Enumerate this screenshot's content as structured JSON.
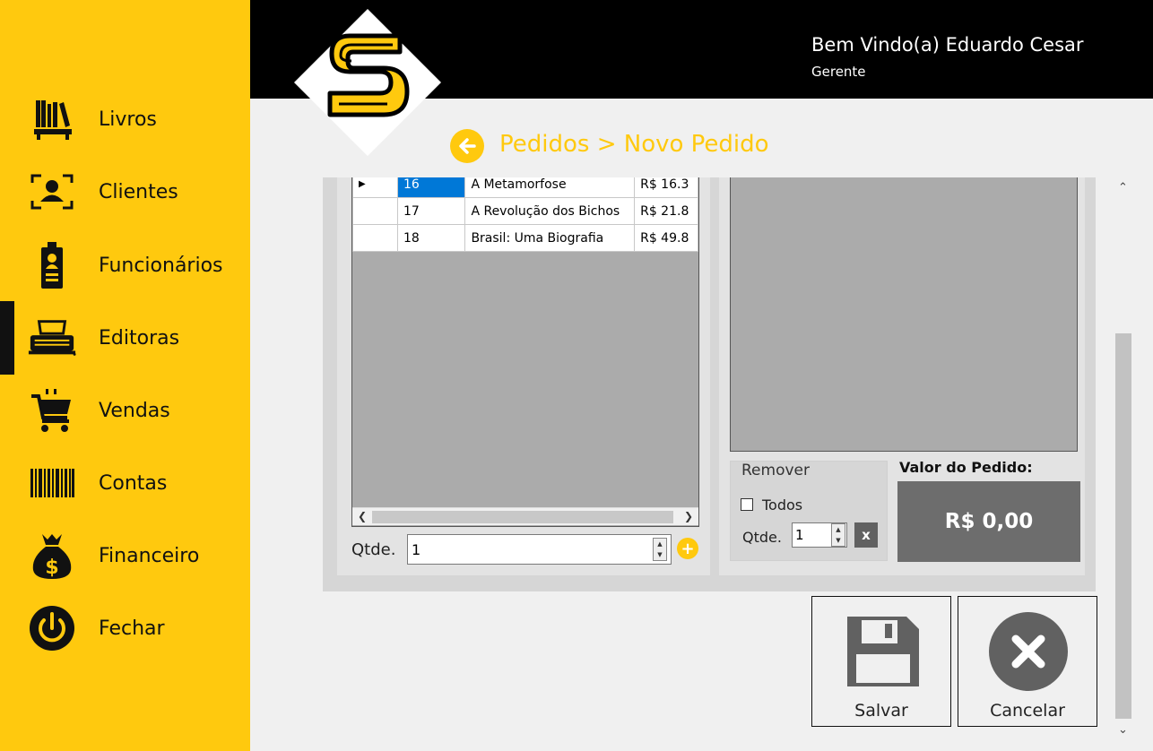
{
  "header": {
    "welcome": "Bem Vindo(a) Eduardo Cesar",
    "role": "Gerente"
  },
  "sidebar": {
    "items": [
      {
        "label": "Livros",
        "icon": "books-icon"
      },
      {
        "label": "Clientes",
        "icon": "client-icon"
      },
      {
        "label": "Funcionários",
        "icon": "badge-icon"
      },
      {
        "label": "Editoras",
        "icon": "typewriter-icon"
      },
      {
        "label": "Vendas",
        "icon": "cart-icon"
      },
      {
        "label": "Contas",
        "icon": "barcode-icon"
      },
      {
        "label": "Financeiro",
        "icon": "money-bag-icon"
      },
      {
        "label": "Fechar",
        "icon": "power-icon"
      }
    ],
    "active": "Editoras"
  },
  "logo": {
    "letter": "S"
  },
  "breadcrumb": "Pedidos > Novo Pedido",
  "books_grid": {
    "rows": [
      {
        "id": "16",
        "title": "A Metamorfose",
        "price": "R$ 16.3",
        "selected": true
      },
      {
        "id": "17",
        "title": "A Revolução dos Bichos",
        "price": "R$ 21.8"
      },
      {
        "id": "18",
        "title": "Brasil: Uma Biografia",
        "price": "R$ 49.8"
      }
    ]
  },
  "add_panel": {
    "qty_label": "Qtde.",
    "qty_value": "1"
  },
  "remove_panel": {
    "title": "Remover",
    "all_label": "Todos",
    "qty_label": "Qtde.",
    "qty_value": "1",
    "remove_glyph": "x"
  },
  "order_value": {
    "label": "Valor do Pedido:",
    "value": "R$ 0,00"
  },
  "actions": {
    "save": "Salvar",
    "cancel": "Cancelar"
  },
  "colors": {
    "accent": "#ffc90e",
    "header_bg": "#000000",
    "value_bg": "#6d6d6d",
    "selection": "#0078d7"
  }
}
